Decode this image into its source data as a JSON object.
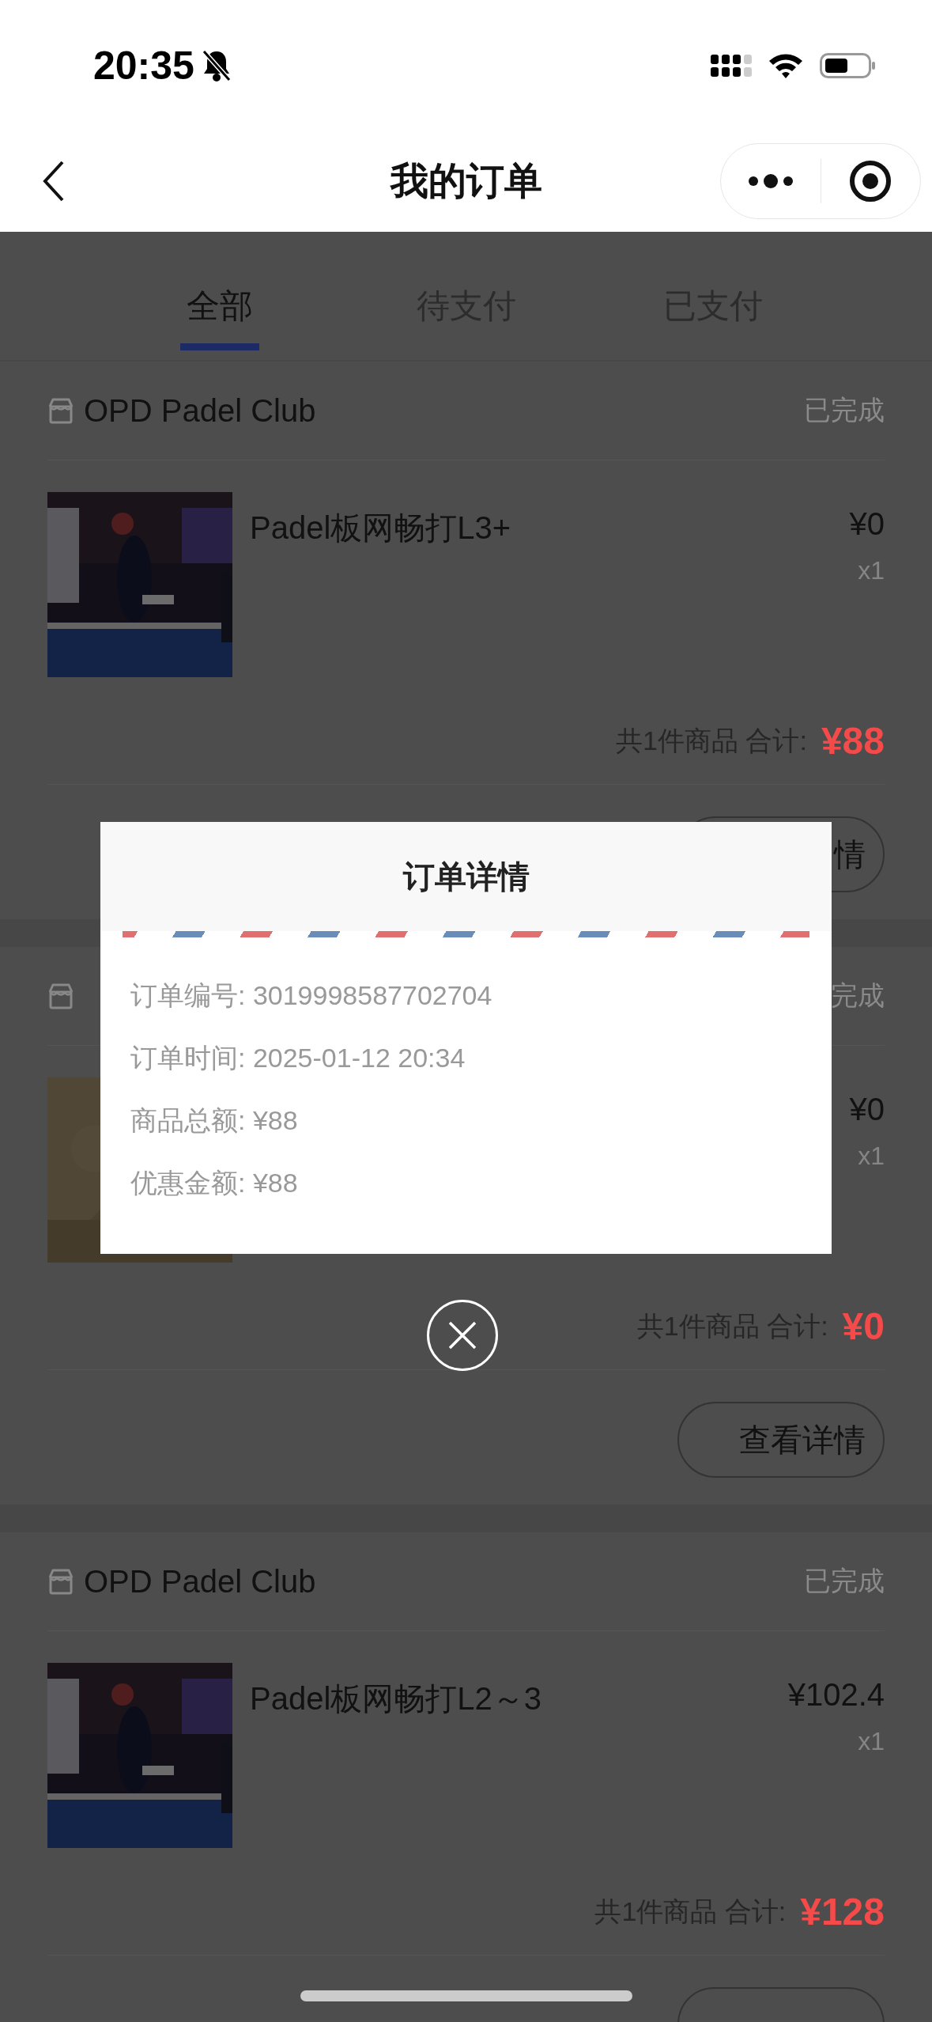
{
  "status_bar": {
    "time": "20:35"
  },
  "nav": {
    "title": "我的订单"
  },
  "tabs": [
    {
      "label": "全部",
      "selected": true
    },
    {
      "label": "待支付",
      "selected": false
    },
    {
      "label": "已支付",
      "selected": false
    }
  ],
  "orders": [
    {
      "shop": "OPD Padel Club",
      "status": "已完成",
      "product": {
        "kind": "picture",
        "name": "Padel板网畅打L3+",
        "price": "¥0",
        "quantity": "x1"
      },
      "summary": "共1件商品 合计:",
      "total": "¥88",
      "button": "情"
    },
    {
      "status": "完成",
      "product": {
        "kind": "picture",
        "price": "¥0",
        "quantity": "x1"
      },
      "summary": "共1件商品 合计:",
      "total": "¥0",
      "button": "查看详情"
    },
    {
      "shop": "OPD Padel Club",
      "status": "已完成",
      "product": {
        "kind": "picture",
        "name": "Padel板网畅打L2～3",
        "price": "¥102.4",
        "quantity": "x1"
      },
      "summary": "共1件商品 合计:",
      "total": "¥128"
    }
  ],
  "modal": {
    "title": "订单详情",
    "rows": [
      "订单编号: 3019998587702704",
      "订单时间: 2025-01-12 20:34",
      "商品总额: ¥88",
      "优惠金额: ¥88"
    ]
  }
}
